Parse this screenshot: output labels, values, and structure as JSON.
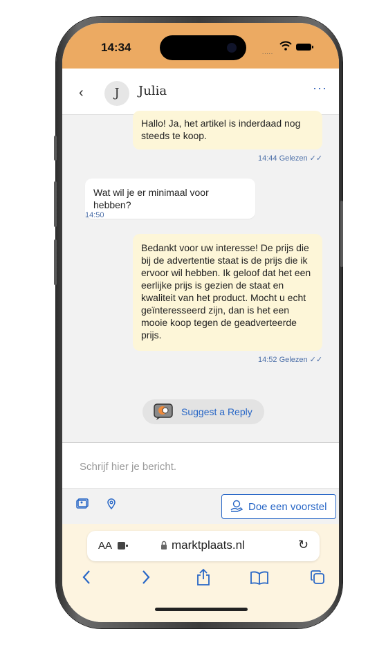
{
  "status_bar": {
    "time": "14:34",
    "signal": "....."
  },
  "header": {
    "back_label": "‹",
    "avatar_initial": "J",
    "contact_name": "Julia",
    "more_label": "···"
  },
  "messages": [
    {
      "direction": "out",
      "text": "Hallo! Ja, het artikel is inderdaad nog steeds te koop.",
      "time": "14:44",
      "status": "Gelezen"
    },
    {
      "direction": "in",
      "text": "Wat wil je er minimaal voor hebben?",
      "time": "14:50"
    },
    {
      "direction": "out",
      "text": "Bedankt voor uw interesse! De prijs die bij de advertentie staat is de prijs die ik ervoor wil hebben. Ik geloof dat het een eerlijke prijs is gezien de staat en kwaliteit van het product. Mocht u echt geïnteresseerd zijn, dan is het een mooie koop tegen de geadverteerde prijs.",
      "time": "14:52",
      "status": "Gelezen"
    }
  ],
  "suggest": {
    "label": "Suggest a Reply",
    "icon": "chat-robot-icon"
  },
  "composer": {
    "placeholder": "Schrijf hier je bericht."
  },
  "toolbar": {
    "photo_icon": "photo-icon",
    "location_icon": "location-pin-icon",
    "proposal_label": "Doe een voorstel",
    "proposal_icon": "hand-coin-icon"
  },
  "browser": {
    "aa_label": "AA",
    "url": "marktplaats.nl",
    "reload_label": "↻",
    "nav": [
      "back-icon",
      "forward-icon",
      "share-icon",
      "bookmarks-icon",
      "tabs-icon"
    ]
  },
  "colors": {
    "status_bar": "#ecaa62",
    "outgoing_bubble": "#fdf6d8",
    "incoming_bubble": "#ffffff",
    "accent": "#2766c6",
    "browser_bar": "#fdf4e0"
  }
}
